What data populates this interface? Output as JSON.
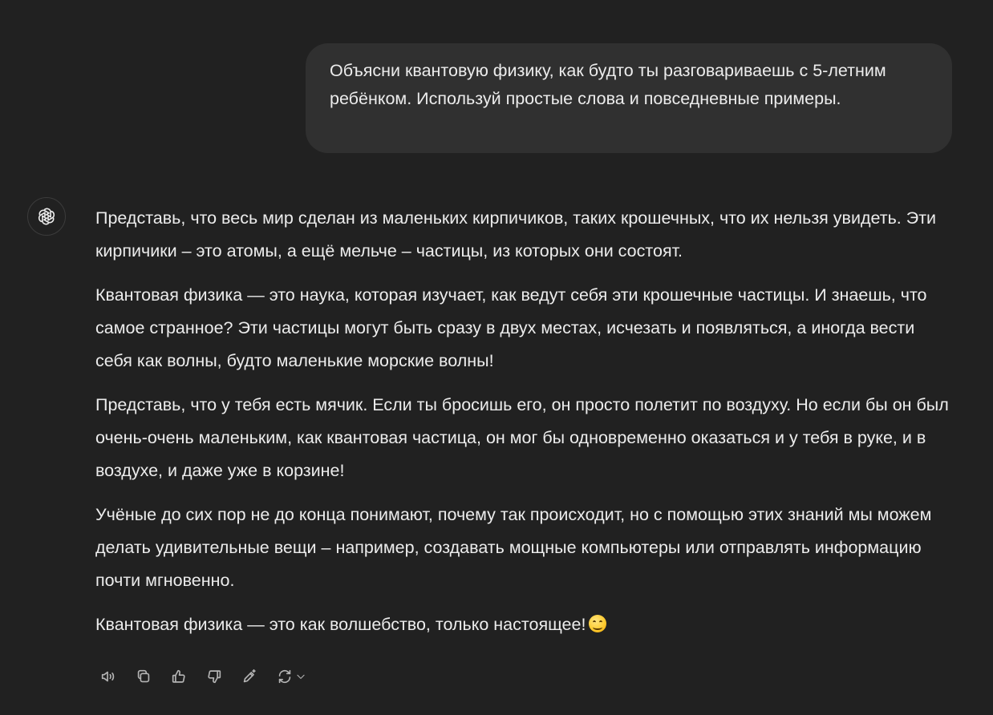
{
  "user_message": {
    "text": "Объясни квантовую физику, как будто ты разговариваешь с 5-летним ребёнком. Используй простые слова и повседневные примеры."
  },
  "assistant": {
    "avatar_icon": "openai-logo-icon",
    "paragraphs": [
      "Представь, что весь мир сделан из маленьких кирпичиков, таких крошечных, что их нельзя увидеть. Эти кирпичики – это атомы, а ещё мельче – частицы, из которых они состоят.",
      "Квантовая физика — это наука, которая изучает, как ведут себя эти крошечные частицы. И знаешь, что самое странное? Эти частицы могут быть сразу в двух местах, исчезать и появляться, а иногда вести себя как волны, будто маленькие морские волны!",
      "Представь, что у тебя есть мячик. Если ты бросишь его, он просто полетит по воздуху. Но если бы он был очень-очень маленьким, как квантовая частица, он мог бы одновременно оказаться и у тебя в руке, и в воздухе, и даже уже в корзине!",
      "Учёные до сих пор не до конца понимают, почему так происходит, но с помощью этих знаний мы можем делать удивительные вещи – например, создавать мощные компьютеры или отправлять информацию почти мгновенно.",
      "Квантовая физика — это как волшебство, только настоящее!"
    ],
    "closing_emoji": "smiling-face-emoji"
  },
  "toolbar": {
    "icons": [
      "speaker-icon",
      "copy-icon",
      "thumbs-up-icon",
      "thumbs-down-icon",
      "edit-canvas-icon",
      "regenerate-icon",
      "chevron-down-icon"
    ]
  },
  "colors": {
    "background": "#212121",
    "user_bubble": "#303030",
    "text": "#ececec",
    "icon": "#b4b4b4"
  }
}
